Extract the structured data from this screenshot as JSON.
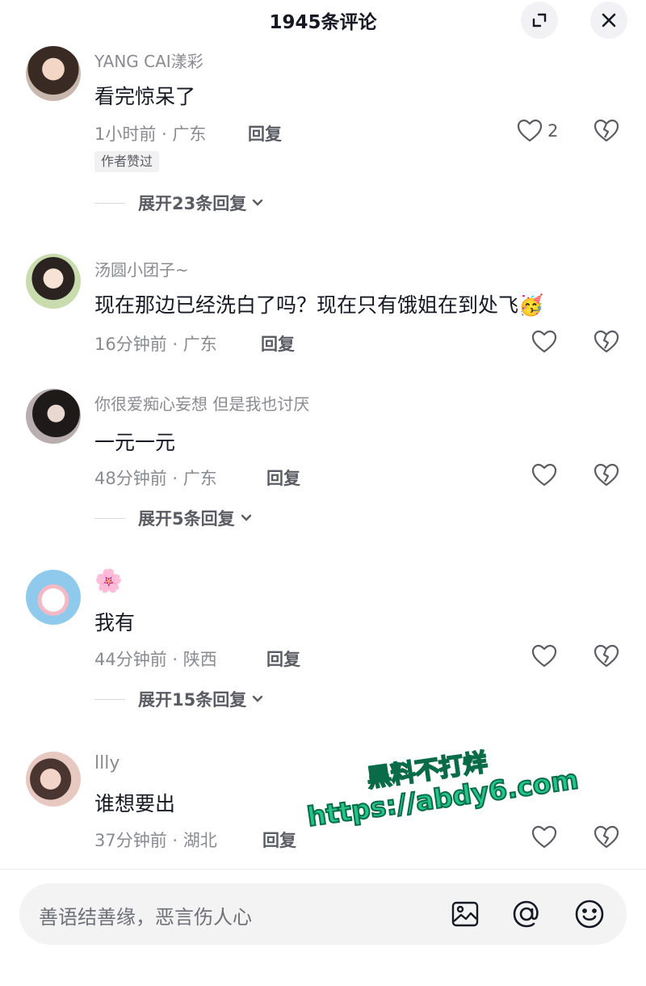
{
  "header": {
    "title": "1945条评论"
  },
  "comments": [
    {
      "username": "YANG CAI漾彩",
      "text": "看完惊呆了",
      "meta": "1小时前 · 广东",
      "reply": "回复",
      "likes": "2",
      "badge": "作者赞过",
      "expand": "展开23条回复"
    },
    {
      "username": "汤圆小团子~",
      "text": "现在那边已经洗白了吗？现在只有饿姐在到处飞",
      "emoji": "🥳",
      "meta": "16分钟前 · 广东",
      "reply": "回复"
    },
    {
      "username": "你很爱痴心妄想 但是我也讨厌",
      "text": "一元一元",
      "meta": "48分钟前 · 广东",
      "reply": "回复",
      "expand": "展开5条回复"
    },
    {
      "username": "🌸",
      "text": "我有",
      "meta": "44分钟前 · 陕西",
      "reply": "回复",
      "expand": "展开15条回复"
    },
    {
      "username": "llly",
      "text": "谁想要出",
      "meta": "37分钟前 · 湖北",
      "reply": "回复"
    }
  ],
  "watermark": {
    "line1": "黑料不打烊",
    "line2": "https://abdy6.com"
  },
  "input": {
    "placeholder": "善语结善缘，恶言伤人心"
  },
  "icons": {
    "expand": "expand-icon",
    "close": "close-icon",
    "like": "heart-icon",
    "dislike": "broken-heart-icon",
    "chevron": "chevron-down-icon",
    "image": "image-icon",
    "mention": "at-icon",
    "emoji": "smiley-icon"
  },
  "colors": {
    "text": "#161823",
    "secondary": "#8a8b91",
    "watermark": "#22c58a"
  }
}
